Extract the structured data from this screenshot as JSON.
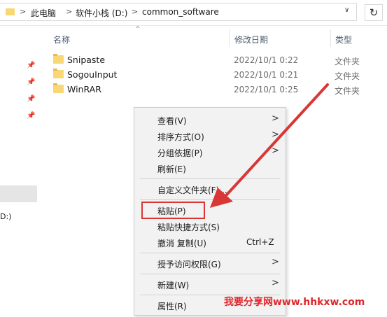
{
  "address_bar": {
    "crumbs": [
      "此电脑",
      "软件小栈 (D:)",
      "common_software"
    ],
    "separator": ">",
    "dropdown_glyph": "∨",
    "refresh_glyph": "↻"
  },
  "nav_pane": {
    "pin_icon": "pin-icon",
    "partial_drive_label": "D:)"
  },
  "columns": {
    "name": "名称",
    "modified": "修改日期",
    "type": "类型",
    "sort_glyph": "^"
  },
  "files": [
    {
      "name": "Snipaste",
      "modified": "2022/10/1 0:22",
      "type": "文件夹"
    },
    {
      "name": "SogouInput",
      "modified": "2022/10/1 0:21",
      "type": "文件夹"
    },
    {
      "name": "WinRAR",
      "modified": "2022/10/1 0:25",
      "type": "文件夹"
    }
  ],
  "context_menu": {
    "items": [
      {
        "label": "查看(V)",
        "submenu": true
      },
      {
        "label": "排序方式(O)",
        "submenu": true
      },
      {
        "label": "分组依据(P)",
        "submenu": true
      },
      {
        "label": "刷新(E)"
      },
      {
        "label": "自定义文件夹(F)..."
      },
      {
        "label": "粘贴(P)"
      },
      {
        "label": "粘贴快捷方式(S)"
      },
      {
        "label": "撤消 复制(U)",
        "shortcut": "Ctrl+Z"
      },
      {
        "label": "授予访问权限(G)",
        "submenu": true
      },
      {
        "label": "新建(W)",
        "submenu": true
      },
      {
        "label": "属性(R)"
      }
    ],
    "submenu_glyph": ">"
  },
  "watermark": "我要分享网www.hhkxw.com",
  "colors": {
    "annotation_red": "#d93636",
    "folder_yellow": "#f8d775",
    "watermark_red": "#e0262c",
    "menu_bg": "#f2f2f2"
  }
}
